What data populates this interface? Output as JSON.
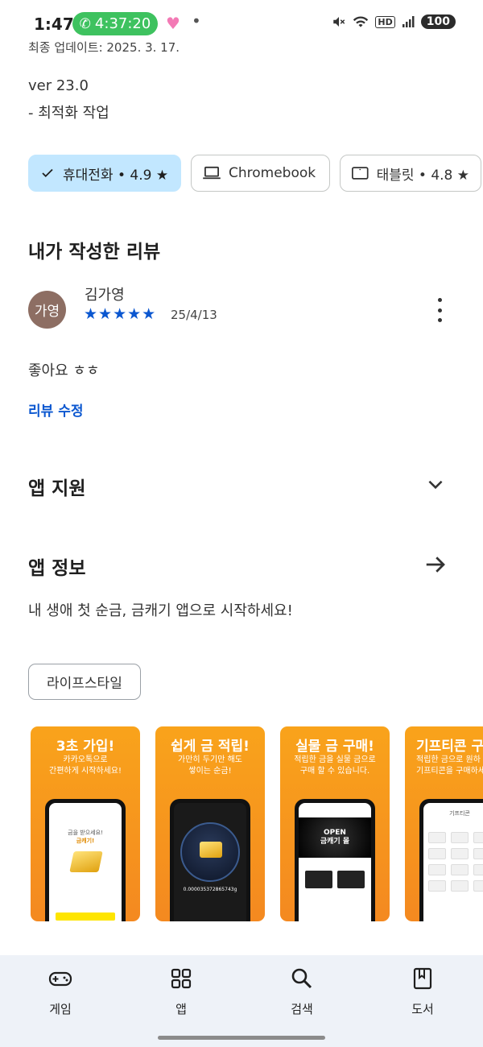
{
  "status_bar": {
    "time": "1:47",
    "call_timer": "4:37:20",
    "battery": "100",
    "hd_label": "HD",
    "signal_label": "5"
  },
  "whats_new": {
    "last_updated": "최종 업데이트: 2025. 3. 17.",
    "version": "ver 23.0",
    "note": "- 최적화 작업"
  },
  "device_chips": [
    {
      "label": "휴대전화 • 4.9 ★",
      "icon": "check-icon",
      "selected": true
    },
    {
      "label": "Chromebook",
      "icon": "laptop-icon",
      "selected": false
    },
    {
      "label": "태블릿 • 4.8 ★",
      "icon": "tablet-icon",
      "selected": false
    }
  ],
  "my_review": {
    "section_title": "내가 작성한 리뷰",
    "avatar_text": "가영",
    "reviewer_name": "김가영",
    "rating_stars": "★★★★★",
    "rating": 5,
    "date": "25/4/13",
    "text": "좋아요 ㅎㅎ",
    "edit_label": "리뷰 수정"
  },
  "app_support": {
    "title": "앱 지원"
  },
  "app_info": {
    "title": "앱 정보",
    "description": "내 생애 첫 순금, 금캐기 앱으로 시작하세요!",
    "category": "라이프스타일"
  },
  "screenshots": [
    {
      "headline": "3초 가입!",
      "subtitle": "카카오톡으로\n간편하게 시작하세요!",
      "screen_text_1": "금을 받으세요!",
      "screen_text_2": "금캐기!"
    },
    {
      "headline": "쉽게 금 적립!",
      "subtitle": "가만히 두기만 해도\n쌓이는 순금!",
      "screen_text_1": "0.000035372865743g"
    },
    {
      "headline": "실물 금 구매!",
      "subtitle": "적립한 금을 실물 금으로\n구매 할 수 있습니다.",
      "screen_text_1": "OPEN\n금캐기 몰"
    },
    {
      "headline": "기프티콘 구",
      "subtitle": "적립한 금으로 원하\n기프티콘을 구매하세",
      "screen_text_1": "기프티콘"
    }
  ],
  "bottom_nav": [
    {
      "label": "게임",
      "icon": "gamepad-icon"
    },
    {
      "label": "앱",
      "icon": "apps-grid-icon"
    },
    {
      "label": "검색",
      "icon": "search-icon"
    },
    {
      "label": "도서",
      "icon": "bookmark-book-icon"
    }
  ],
  "colors": {
    "accent_blue": "#0b57d0",
    "chip_selected_bg": "#c2e7ff",
    "call_green": "#3ec25f",
    "avatar_brown": "#8d6e63",
    "nav_bg": "#eef2f8",
    "screenshot_orange": "#f9a31b"
  }
}
